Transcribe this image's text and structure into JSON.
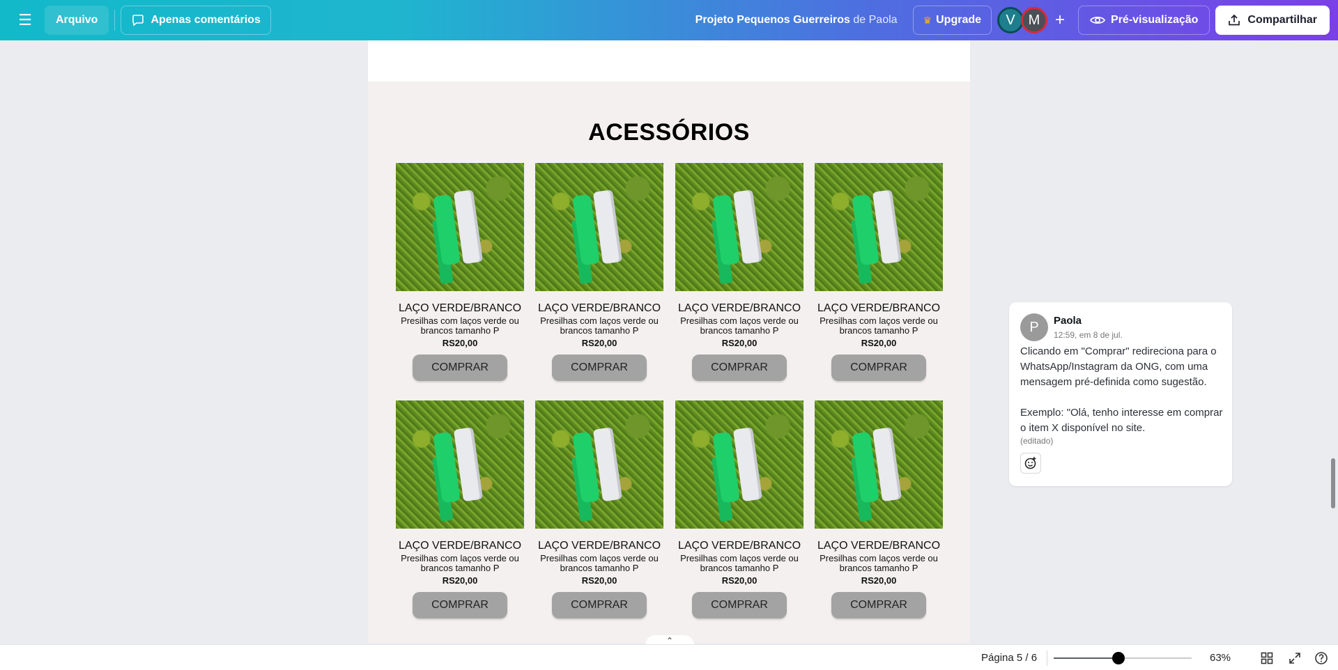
{
  "topbar": {
    "menu_icon": "hamburger-icon",
    "file_label": "Arquivo",
    "comments_label": "Apenas comentários",
    "project_title": "Projeto Pequenos Guerreiros",
    "project_owner_prefix": "de",
    "project_owner": "Paola",
    "upgrade_label": "Upgrade",
    "avatars": [
      "V",
      "M"
    ],
    "add_collaborator": "+",
    "preview_label": "Pré-visualização",
    "share_label": "Compartilhar"
  },
  "page": {
    "section_title": "ACESSÓRIOS",
    "products": [
      {
        "name": "LAÇO VERDE/BRANCO",
        "desc": "Presilhas com laços verde ou brancos tamanho P",
        "price": "RS20,00",
        "button": "COMPRAR"
      },
      {
        "name": "LAÇO VERDE/BRANCO",
        "desc": "Presilhas com laços verde ou brancos tamanho P",
        "price": "RS20,00",
        "button": "COMPRAR"
      },
      {
        "name": "LAÇO VERDE/BRANCO",
        "desc": "Presilhas com laços verde ou brancos tamanho P",
        "price": "RS20,00",
        "button": "COMPRAR"
      },
      {
        "name": "LAÇO VERDE/BRANCO",
        "desc": "Presilhas com laços verde ou brancos tamanho P",
        "price": "RS20,00",
        "button": "COMPRAR"
      },
      {
        "name": "LAÇO VERDE/BRANCO",
        "desc": "Presilhas com laços verde ou brancos tamanho P",
        "price": "RS20,00",
        "button": "COMPRAR"
      },
      {
        "name": "LAÇO VERDE/BRANCO",
        "desc": "Presilhas com laços verde ou brancos tamanho P",
        "price": "RS20,00",
        "button": "COMPRAR"
      },
      {
        "name": "LAÇO VERDE/BRANCO",
        "desc": "Presilhas com laços verde ou brancos tamanho P",
        "price": "RS20,00",
        "button": "COMPRAR"
      },
      {
        "name": "LAÇO VERDE/BRANCO",
        "desc": "Presilhas com laços verde ou brancos tamanho P",
        "price": "RS20,00",
        "button": "COMPRAR"
      }
    ]
  },
  "comment": {
    "avatar": "P",
    "author": "Paola",
    "time": "12:59, em 8 de jul.",
    "body": "Clicando em \"Comprar\" redireciona para o WhatsApp/Instagram da ONG, com uma mensagem pré-definida como sugestão.\n\nExemplo: \"Olá, tenho interesse em comprar o item X disponível no site.",
    "edited": "(editado)",
    "reaction_icon": "add-reaction-icon"
  },
  "bottombar": {
    "page_indicator": "Página 5 / 6",
    "zoom_label": "63%",
    "zoom_fraction": 0.47,
    "grid_icon": "grid-view-icon",
    "fullscreen_icon": "fullscreen-icon",
    "help_icon": "help-icon"
  },
  "colors": {
    "button_gray": "#a3a3a3",
    "page_bg": "#f3f0ef",
    "workspace_bg": "#ebecf0"
  }
}
